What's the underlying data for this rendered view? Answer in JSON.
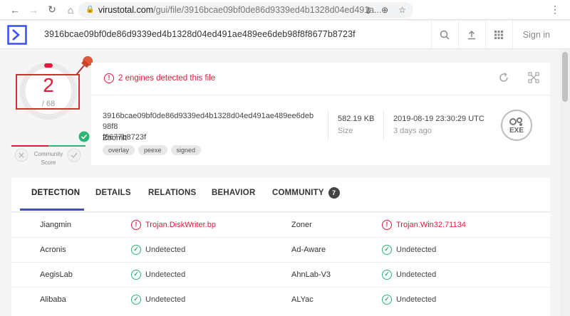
{
  "browser": {
    "url_host": "virustotal.com",
    "url_path": "/gui/file/3916bcae09bf0de86d9339ed4b1328d04ed491a..."
  },
  "header": {
    "hash": "3916bcae09bf0de86d9339ed4b1328d04ed491ae489ee6deb98f8f8677b8723f",
    "signin_label": "Sign in"
  },
  "score": {
    "detections": "2",
    "total": "/ 68",
    "community_label_1": "Community",
    "community_label_2": "Score"
  },
  "alert": {
    "text": "2 engines detected this file"
  },
  "file": {
    "hash_line1": "3916bcae09bf0de86d9339ed4b1328d04ed491ae489ee6deb98f8",
    "hash_line2": "f8677b8723f",
    "name": "ZoomIt",
    "tags": [
      "overlay",
      "peexe",
      "signed"
    ],
    "size": "582.19 KB",
    "size_label": "Size",
    "date": "2019-08-19 23:30:29 UTC",
    "date_label": "3 days ago",
    "type": "EXE"
  },
  "tabs": {
    "detection": "DETECTION",
    "details": "DETAILS",
    "relations": "RELATIONS",
    "behavior": "BEHAVIOR",
    "community": "COMMUNITY",
    "community_count": "7"
  },
  "results": [
    {
      "left_engine": "Jiangmin",
      "left_result": "Trojan.DiskWriter.bp",
      "left_status": "bad",
      "right_engine": "Zoner",
      "right_result": "Trojan.Win32.71134",
      "right_status": "bad"
    },
    {
      "left_engine": "Acronis",
      "left_result": "Undetected",
      "left_status": "ok",
      "right_engine": "Ad-Aware",
      "right_result": "Undetected",
      "right_status": "ok"
    },
    {
      "left_engine": "AegisLab",
      "left_result": "Undetected",
      "left_status": "ok",
      "right_engine": "AhnLab-V3",
      "right_result": "Undetected",
      "right_status": "ok"
    },
    {
      "left_engine": "Alibaba",
      "left_result": "Undetected",
      "left_status": "ok",
      "right_engine": "ALYac",
      "right_result": "Undetected",
      "right_status": "ok"
    }
  ],
  "colors": {
    "danger": "#e8183a",
    "ok": "#2bb673",
    "accent": "#3f51b5"
  }
}
